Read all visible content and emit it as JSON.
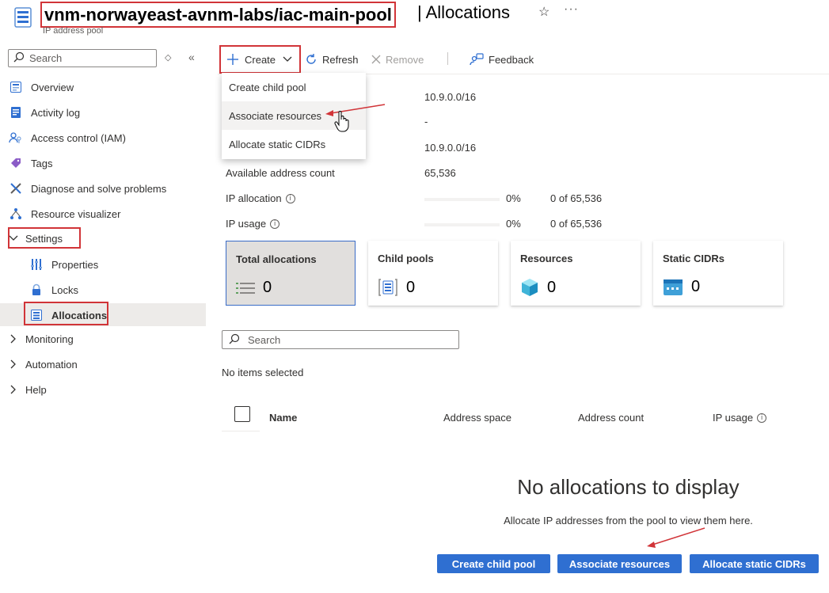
{
  "header": {
    "resource_name": "vnm-norwayeast-avnm-labs/iac-main-pool",
    "separator_title": "| Allocations",
    "subtitle": "IP address pool"
  },
  "sidebar": {
    "search_placeholder": "Search",
    "items": [
      {
        "label": "Overview",
        "icon": "overview-icon"
      },
      {
        "label": "Activity log",
        "icon": "activity-log-icon"
      },
      {
        "label": "Access control (IAM)",
        "icon": "iam-icon"
      },
      {
        "label": "Tags",
        "icon": "tag-icon"
      },
      {
        "label": "Diagnose and solve problems",
        "icon": "wrench-icon"
      },
      {
        "label": "Resource visualizer",
        "icon": "visualizer-icon"
      },
      {
        "label": "Settings",
        "expanded": true
      },
      {
        "label": "Properties",
        "icon": "properties-icon"
      },
      {
        "label": "Locks",
        "icon": "lock-icon"
      },
      {
        "label": "Allocations",
        "icon": "allocations-icon",
        "selected": true
      },
      {
        "label": "Monitoring"
      },
      {
        "label": "Automation"
      },
      {
        "label": "Help"
      }
    ]
  },
  "toolbar": {
    "create": "Create",
    "refresh": "Refresh",
    "remove": "Remove",
    "feedback": "Feedback"
  },
  "dropdown": {
    "items": [
      "Create child pool",
      "Associate resources",
      "Allocate static CIDRs"
    ]
  },
  "essentials": {
    "address_space_1": "10.9.0.0/16",
    "dash": "-",
    "address_space_2": "10.9.0.0/16",
    "available_label": "Available address count",
    "available_value": "65,536",
    "ip_allocation_label": "IP allocation",
    "ip_allocation_pct": "0%",
    "ip_allocation_of": "0 of 65,536",
    "ip_allocation_fill": 0,
    "ip_usage_label": "IP usage",
    "ip_usage_pct": "0%",
    "ip_usage_of": "0 of 65,536",
    "ip_usage_fill": 0
  },
  "cards": [
    {
      "title": "Total allocations",
      "value": "0",
      "icon": "list-icon"
    },
    {
      "title": "Child pools",
      "value": "0",
      "icon": "child-pool-icon"
    },
    {
      "title": "Resources",
      "value": "0",
      "icon": "cube-icon"
    },
    {
      "title": "Static CIDRs",
      "value": "0",
      "icon": "cidr-icon"
    }
  ],
  "list": {
    "search_placeholder": "Search",
    "selection_status": "No items selected",
    "columns": [
      "Name",
      "Address space",
      "Address count",
      "IP usage"
    ]
  },
  "empty": {
    "title": "No allocations to display",
    "subtitle": "Allocate IP addresses from the pool to view them here.",
    "buttons": [
      "Create child pool",
      "Associate resources",
      "Allocate static CIDRs"
    ]
  },
  "colors": {
    "accent": "#2f6fd1",
    "highlight": "#d13438"
  }
}
